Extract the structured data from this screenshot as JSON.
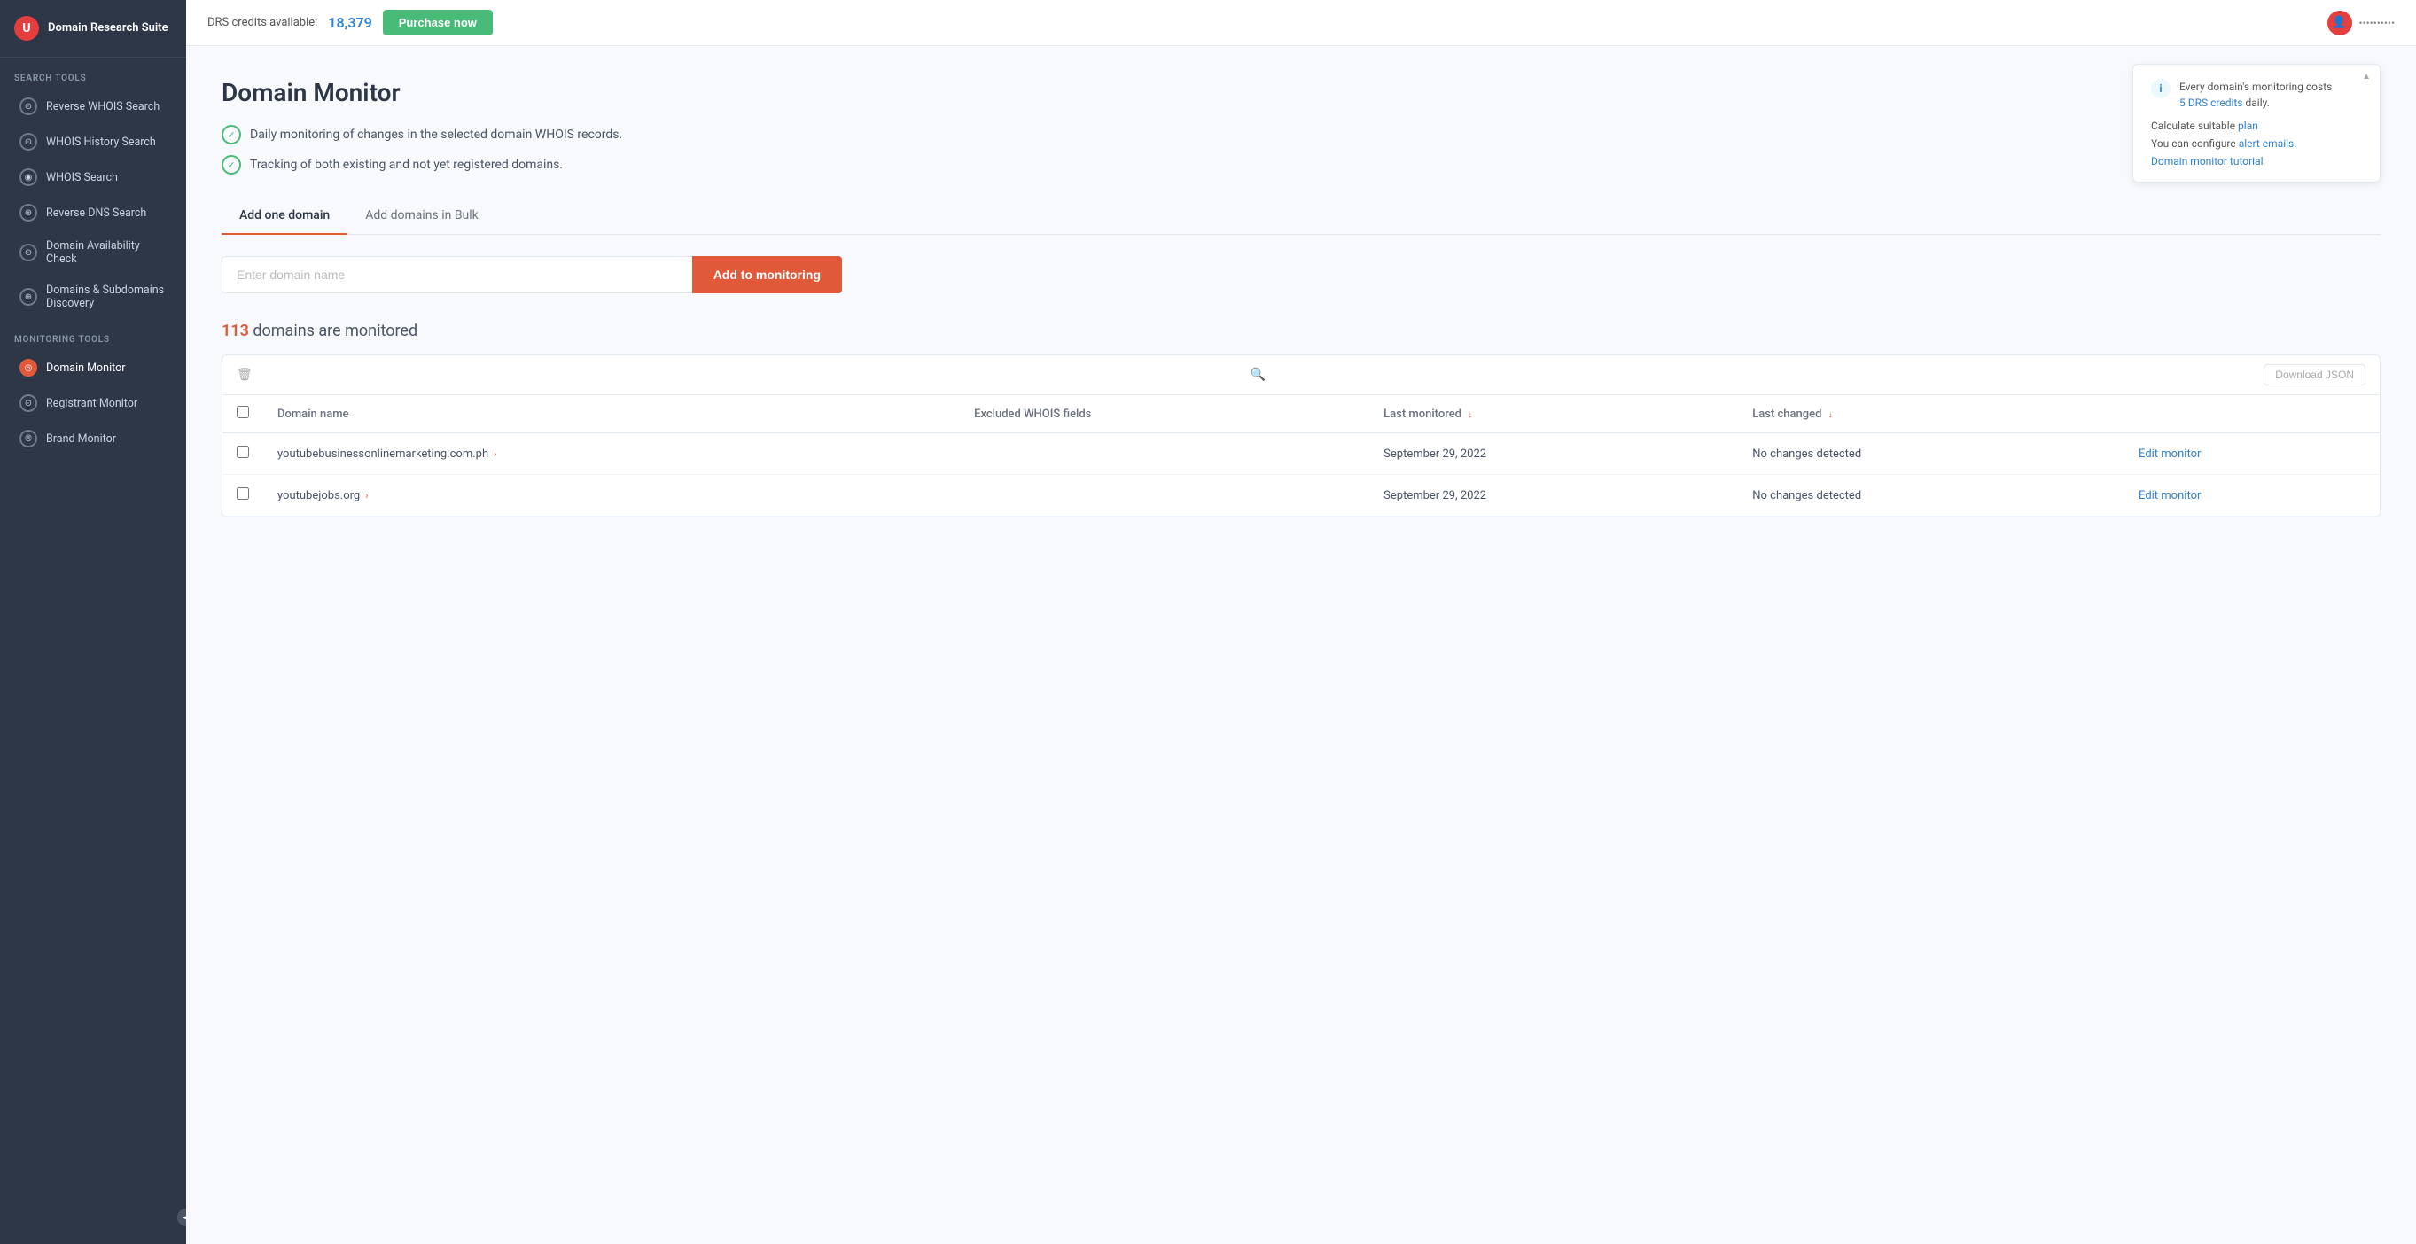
{
  "sidebar": {
    "logo_icon": "U",
    "logo_text": "Domain Research Suite",
    "search_tools_label": "Search tools",
    "monitoring_tools_label": "Monitoring tools",
    "search_items": [
      {
        "id": "reverse-whois",
        "label": "Reverse WHOIS Search",
        "icon": "⊙"
      },
      {
        "id": "whois-history",
        "label": "WHOIS History Search",
        "icon": "⊙"
      },
      {
        "id": "whois-search",
        "label": "WHOIS Search",
        "icon": "◉"
      },
      {
        "id": "reverse-dns",
        "label": "Reverse DNS Search",
        "icon": "⊕"
      },
      {
        "id": "domain-availability",
        "label": "Domain Availability Check",
        "icon": "⊙"
      },
      {
        "id": "subdomains",
        "label": "Domains & Subdomains Discovery",
        "icon": "⊕"
      }
    ],
    "monitoring_items": [
      {
        "id": "domain-monitor",
        "label": "Domain Monitor",
        "icon": "◎",
        "active": true
      },
      {
        "id": "registrant-monitor",
        "label": "Registrant Monitor",
        "icon": "⊙"
      },
      {
        "id": "brand-monitor",
        "label": "Brand Monitor",
        "icon": "®"
      }
    ]
  },
  "topbar": {
    "credits_label": "DRS credits available:",
    "credits_value": "18,379",
    "purchase_label": "Purchase now",
    "user_name": "••••••••••"
  },
  "info_panel": {
    "main_text": "Every domain's monitoring costs",
    "credits_text": "5 DRS credits",
    "credits_suffix": " daily.",
    "calculate_label": "Calculate suitable",
    "plan_link": "plan",
    "configure_text": "You can configure",
    "alert_link": "alert emails.",
    "tutorial_link": "Domain monitor tutorial"
  },
  "page": {
    "title": "Domain Monitor",
    "features": [
      "Daily monitoring of changes in the selected domain WHOIS records.",
      "Tracking of both existing and not yet registered domains."
    ],
    "tabs": [
      {
        "id": "add-one",
        "label": "Add one domain",
        "active": true
      },
      {
        "id": "add-bulk",
        "label": "Add domains in Bulk",
        "active": false
      }
    ],
    "input_placeholder": "Enter domain name",
    "add_button_label": "Add to monitoring",
    "domains_count": "113",
    "domains_suffix": " domains are monitored",
    "download_btn_label": "Download JSON",
    "table": {
      "columns": [
        {
          "id": "domain-name",
          "label": "Domain name"
        },
        {
          "id": "excluded-whois",
          "label": "Excluded WHOIS fields"
        },
        {
          "id": "last-monitored",
          "label": "Last monitored",
          "sortable": true
        },
        {
          "id": "last-changed",
          "label": "Last changed",
          "sortable": true
        },
        {
          "id": "actions",
          "label": ""
        }
      ],
      "rows": [
        {
          "domain": "youtubebusinessonlinemarketing.com.ph",
          "excluded": "",
          "last_monitored": "September 29, 2022",
          "last_changed": "No changes detected",
          "edit_label": "Edit monitor"
        },
        {
          "domain": "youtubejobs.org",
          "excluded": "",
          "last_monitored": "September 29, 2022",
          "last_changed": "No changes detected",
          "edit_label": "Edit monitor"
        }
      ]
    }
  }
}
